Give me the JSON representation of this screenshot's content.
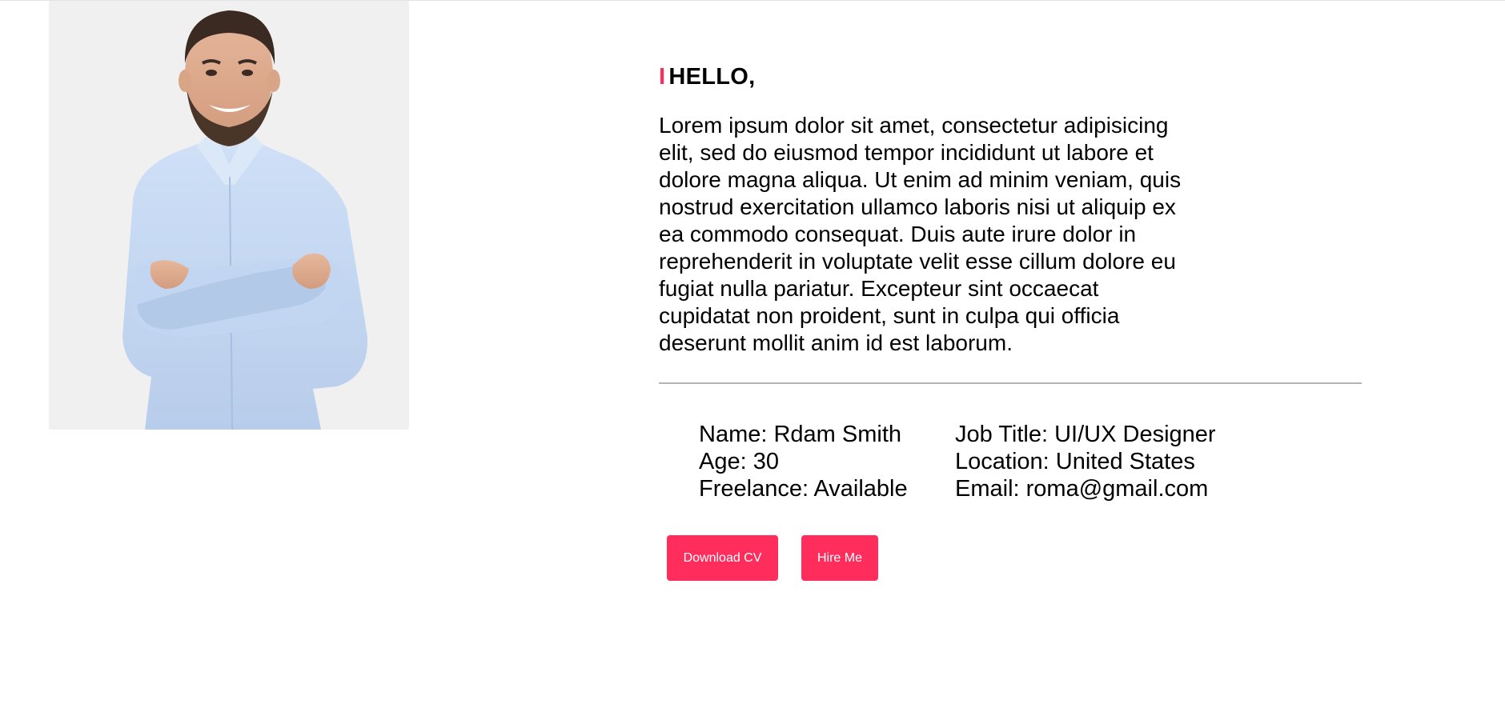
{
  "about": {
    "hello": "HELLO,",
    "hello_bar": "I",
    "intro": "Lorem ipsum dolor sit amet, consectetur adipisicing elit, sed do eiusmod tempor incididunt ut labore et dolore magna aliqua. Ut enim ad minim veniam, quis nostrud exercitation ullamco laboris nisi ut aliquip ex ea commodo consequat. Duis aute irure dolor in reprehenderit in voluptate velit esse cillum dolore eu fugiat nulla pariatur. Excepteur sint occaecat cupidatat non proident, sunt in culpa qui officia deserunt mollit anim id est laborum."
  },
  "info": {
    "left": [
      "Name: Rdam Smith",
      "Age: 30",
      "Freelance: Available"
    ],
    "right": [
      "Job Title: UI/UX Designer",
      "Location: United States",
      "Email: roma@gmail.com"
    ]
  },
  "buttons": {
    "download_cv": "Download CV",
    "hire_me": "Hire Me"
  },
  "colors": {
    "accent": "#ff2d5c",
    "photo_bg": "#f0f0f0",
    "divider": "#b3b3b3"
  }
}
